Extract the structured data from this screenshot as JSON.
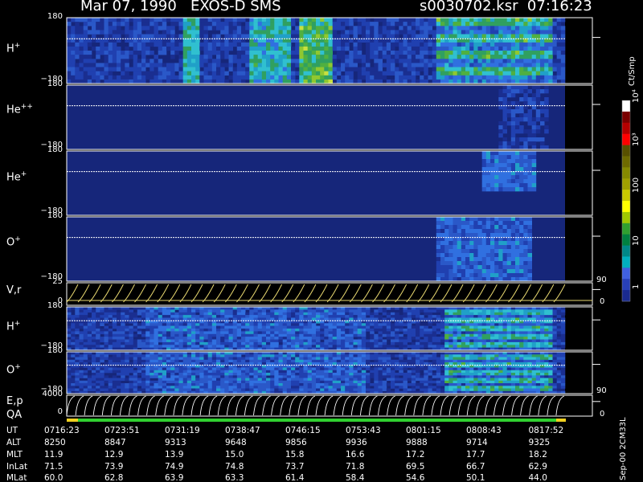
{
  "header": {
    "date_instrument": "Mar 07, 1990   EXOS-D SMS",
    "file_time": "s0030702.ksr  07:16:23"
  },
  "panels": [
    {
      "name": "h-plus-spin",
      "label_base": "H",
      "label_sup": "+",
      "top": "180",
      "bottom": "−180"
    },
    {
      "name": "he-plusplus",
      "label_base": "He",
      "label_sup": "++",
      "top": "180",
      "bottom": "−180"
    },
    {
      "name": "he-plus",
      "label_base": "He",
      "label_sup": "+",
      "top": "180",
      "bottom": "−180"
    },
    {
      "name": "o-plus-spin",
      "label_base": "O",
      "label_sup": "+",
      "top": "180",
      "bottom": "−180"
    },
    {
      "name": "velocity",
      "label_base": "V,r",
      "label_sup": "",
      "top": "25",
      "bottom": "0"
    },
    {
      "name": "h-plus-lower",
      "label_base": "H",
      "label_sup": "+",
      "top": "180",
      "bottom": "−180"
    },
    {
      "name": "o-plus-lower",
      "label_base": "O",
      "label_sup": "+",
      "top": "180",
      "bottom": "−180"
    },
    {
      "name": "energy",
      "label_base": "E,p",
      "label_sup": "",
      "top": "4000",
      "bottom": "0"
    }
  ],
  "right_ticks": {
    "velocity_top": "90",
    "velocity_bottom": "0",
    "energy_top": "90",
    "energy_bottom": "0"
  },
  "qa_label": "QA",
  "colorbar": {
    "unit": "Ct/Smp",
    "ticks": [
      "10⁴",
      "10³",
      "100",
      "10",
      "1"
    ],
    "colors": [
      "#ffffff",
      "#7a0000",
      "#b40000",
      "#ff0000",
      "#585000",
      "#6e6a00",
      "#868a00",
      "#a0a000",
      "#c8c800",
      "#ffff00",
      "#a0c800",
      "#30a030",
      "#008040",
      "#008888",
      "#00b0c0",
      "#4060e0",
      "#2840b8",
      "#1a2a90"
    ]
  },
  "ephemeris": {
    "labels": [
      "UT",
      "ALT",
      "MLT",
      "InLat",
      "MLat"
    ],
    "rows": [
      [
        "0716:23",
        "0723:51",
        "0731:19",
        "0738:47",
        "0746:15",
        "0753:43",
        "0801:15",
        "0808:43",
        "0817:52"
      ],
      [
        "8250",
        "8847",
        "9313",
        "9648",
        "9856",
        "9936",
        "9888",
        "9714",
        "9325"
      ],
      [
        "11.9",
        "12.9",
        "13.9",
        "15.0",
        "15.8",
        "16.6",
        "17.2",
        "17.7",
        "18.2"
      ],
      [
        "71.5",
        "73.9",
        "74.9",
        "74.8",
        "73.7",
        "71.8",
        "69.5",
        "66.7",
        "62.9"
      ],
      [
        "60.0",
        "62.8",
        "63.9",
        "63.3",
        "61.4",
        "58.4",
        "54.6",
        "50.1",
        "44.0"
      ]
    ]
  },
  "footer_vertical": "Sep-00  2CM33L"
}
